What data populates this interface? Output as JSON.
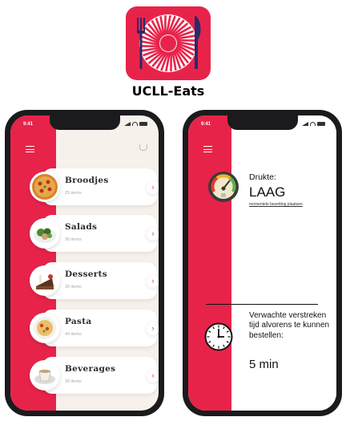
{
  "app": {
    "name": "UCLL-Eats",
    "icon": "plate-fork-knife-logo"
  },
  "colors": {
    "accent": "#e8234a",
    "background": "#f7f1ec"
  },
  "phone_left": {
    "status_time": "9:41",
    "menu_icon": "hamburger-icon",
    "cart_icon": "basket-icon",
    "categories": [
      {
        "name": "Broodjes",
        "count": "25 items",
        "icon": "pizza-image"
      },
      {
        "name": "Salads",
        "count": "30 items",
        "icon": "salad-image"
      },
      {
        "name": "Desserts",
        "count": "30 items",
        "icon": "cake-image"
      },
      {
        "name": "Pasta",
        "count": "44 items",
        "icon": "pasta-image"
      },
      {
        "name": "Beverages",
        "count": "30 items",
        "icon": "drink-image"
      }
    ]
  },
  "phone_right": {
    "status_time": "9:41",
    "menu_icon": "hamburger-icon",
    "crowd": {
      "label": "Drukte:",
      "value": "LAAG",
      "link": "momentele bezetting plaatsen",
      "icon": "gauge-icon"
    },
    "wait": {
      "label": "Verwachte verstreken tijd alvorens te kunnen bestellen:",
      "value": "5 min",
      "icon": "clock-icon"
    }
  }
}
